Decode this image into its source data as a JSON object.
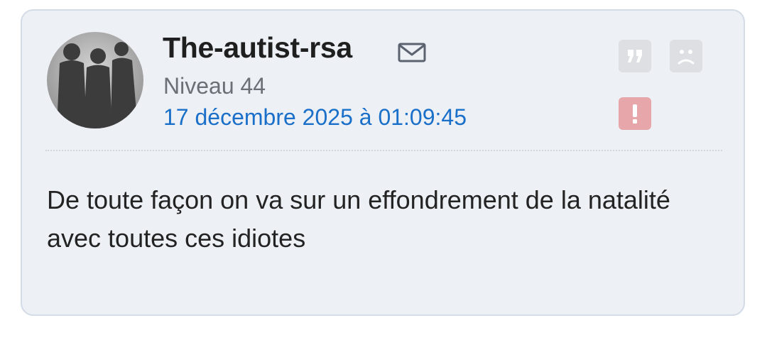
{
  "post": {
    "author": "The-autist-rsa",
    "level": "Niveau 44",
    "date": "17 décembre 2025 à 01:09:45",
    "message": "De toute façon on va sur un effondrement de la natalité avec toutes ces idiotes"
  },
  "icons": {
    "mail": "envelope-icon",
    "quote": "quote-icon",
    "sad": "sad-face-icon",
    "alert": "exclamation-icon"
  },
  "colors": {
    "card_background": "#edf0f5",
    "card_border": "#d3dbe6",
    "date_link": "#1a6fc9",
    "action_button": "#dddfe3",
    "report_button": "#e7a6aa"
  }
}
